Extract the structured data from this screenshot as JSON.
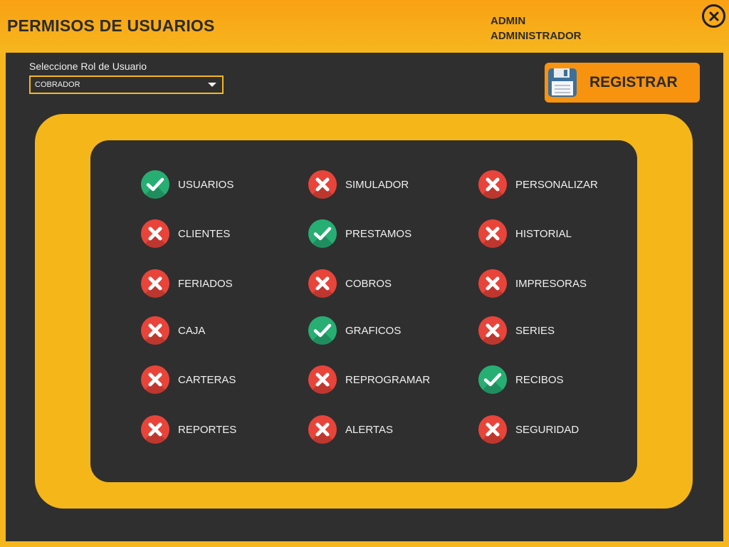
{
  "header": {
    "title": "PERMISOS DE USUARIOS",
    "user_name": "ADMIN",
    "user_role": "ADMINISTRADOR"
  },
  "role": {
    "label": "Seleccione Rol de Usuario",
    "selected": "COBRADOR"
  },
  "actions": {
    "register_label": "REGISTRAR"
  },
  "colors": {
    "accent": "#f6b61e",
    "register_button": "#f7930f",
    "granted": "#27ae73",
    "denied": "#e8443a",
    "background": "#2f2f2f"
  },
  "permissions": [
    {
      "label": "USUARIOS",
      "granted": true
    },
    {
      "label": "SIMULADOR",
      "granted": false
    },
    {
      "label": "PERSONALIZAR",
      "granted": false
    },
    {
      "label": "CLIENTES",
      "granted": false
    },
    {
      "label": "PRESTAMOS",
      "granted": true
    },
    {
      "label": "HISTORIAL",
      "granted": false
    },
    {
      "label": "FERIADOS",
      "granted": false
    },
    {
      "label": "COBROS",
      "granted": false
    },
    {
      "label": "IMPRESORAS",
      "granted": false
    },
    {
      "label": "CAJA",
      "granted": false
    },
    {
      "label": "GRAFICOS",
      "granted": true
    },
    {
      "label": "SERIES",
      "granted": false
    },
    {
      "label": "CARTERAS",
      "granted": false
    },
    {
      "label": "REPROGRAMAR",
      "granted": false
    },
    {
      "label": "RECIBOS",
      "granted": true
    },
    {
      "label": "REPORTES",
      "granted": false
    },
    {
      "label": "ALERTAS",
      "granted": false
    },
    {
      "label": "SEGURIDAD",
      "granted": false
    }
  ]
}
